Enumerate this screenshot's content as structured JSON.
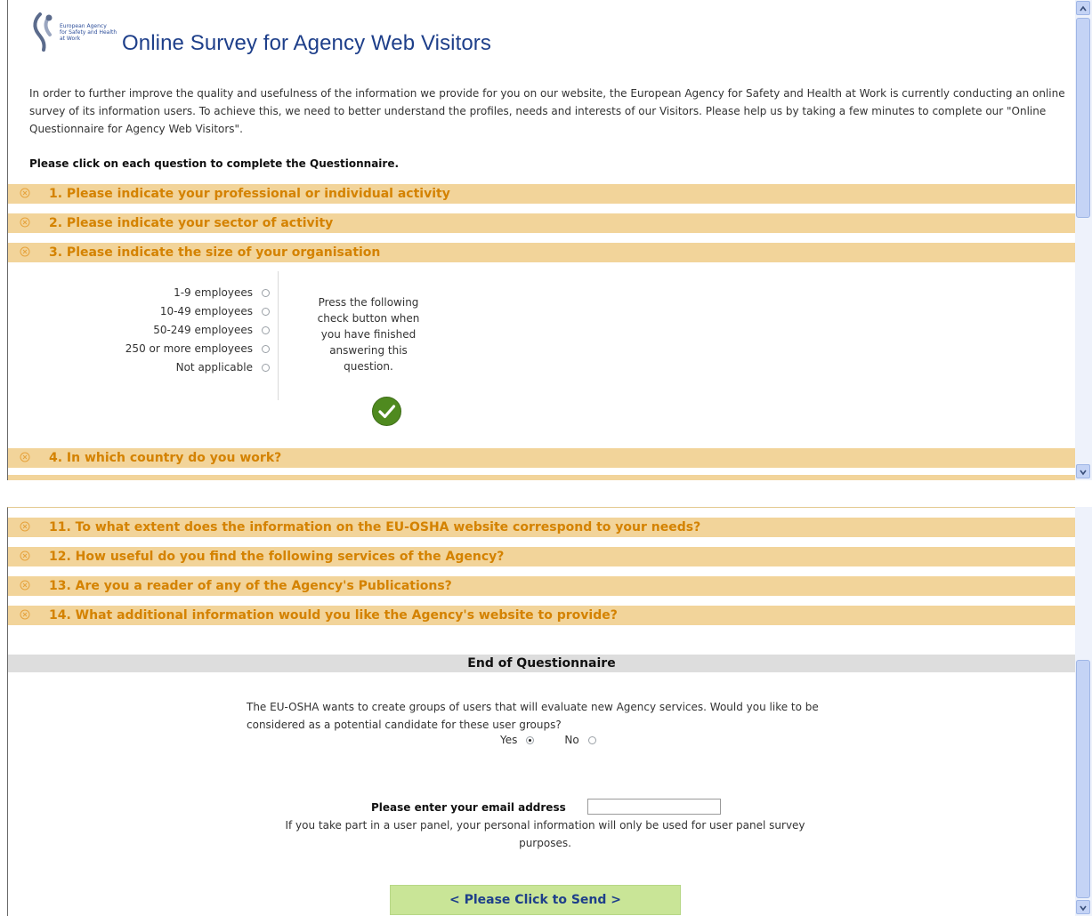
{
  "header": {
    "logo_lines": [
      "European Agency",
      "for Safety and Health",
      "at Work"
    ],
    "title": "Online Survey for Agency Web Visitors"
  },
  "intro": {
    "paragraph": "In order to further improve the quality and usefulness of the information we provide for you on our website, the European Agency for Safety and Health at Work is currently conducting an online survey of its information users. To achieve this, we need to better understand the profiles, needs and interests of our Visitors. Please help us by taking a few minutes to complete our \"Online Questionnaire for Agency Web Visitors\".",
    "instruction": "Please click on each question to complete the Questionnaire."
  },
  "questions_top": [
    {
      "label": "1. Please indicate your professional or individual activity"
    },
    {
      "label": "2. Please indicate your sector of activity"
    },
    {
      "label": "3. Please indicate the size of your organisation"
    },
    {
      "label": "4. In which country do you work?"
    }
  ],
  "q3": {
    "options": [
      "1-9 employees",
      "10-49 employees",
      "50-249 employees",
      "250 or more employees",
      "Not applicable"
    ],
    "hint": "Press the following check button when you have finished answering this question."
  },
  "questions_bottom": [
    {
      "label": "11. To what extent does the information on the EU-OSHA website correspond to your needs?"
    },
    {
      "label": "12. How useful do you find the following services of the Agency?"
    },
    {
      "label": "13. Are you a reader of any of the Agency's Publications?"
    },
    {
      "label": "14. What additional information would you like the Agency's website to provide?"
    }
  ],
  "end": {
    "title": "End of Questionnaire",
    "user_group_question": "The EU-OSHA wants to create groups of users that will evaluate new Agency services. Would you like to be considered as a potential candidate for these user groups?",
    "yes_label": "Yes",
    "no_label": "No",
    "yes_selected": true,
    "email_label": "Please enter your email address",
    "email_value": "",
    "privacy_note": "If you take part in a user panel, your personal information will only be used for user panel survey purposes.",
    "send_label": "< Please Click to Send >"
  },
  "colors": {
    "question_bar": "#f2d49a",
    "question_text": "#d48200",
    "title_blue": "#1e3f8a",
    "send_button": "#c9e597",
    "check_green": "#4f8a1f"
  }
}
